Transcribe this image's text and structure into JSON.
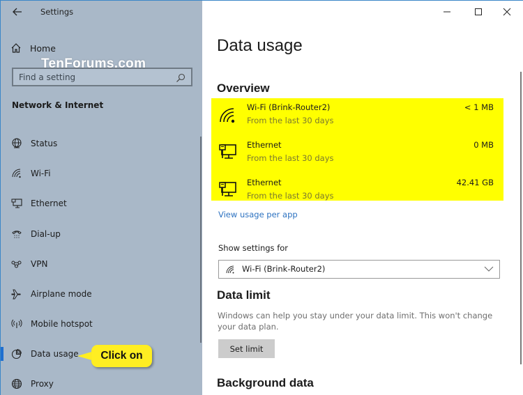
{
  "window": {
    "app_title": "Settings",
    "controls": {
      "minimize": "minimize-icon",
      "maximize": "maximize-icon",
      "close": "close-icon"
    }
  },
  "sidebar": {
    "home_label": "Home",
    "watermark": "TenForums.com",
    "search_placeholder": "Find a setting",
    "section_title": "Network & Internet",
    "items": [
      {
        "label": "Status",
        "icon": "status-globe-icon",
        "active": false
      },
      {
        "label": "Wi-Fi",
        "icon": "wifi-icon",
        "active": false
      },
      {
        "label": "Ethernet",
        "icon": "ethernet-icon",
        "active": false
      },
      {
        "label": "Dial-up",
        "icon": "dialup-phone-icon",
        "active": false
      },
      {
        "label": "VPN",
        "icon": "vpn-icon",
        "active": false
      },
      {
        "label": "Airplane mode",
        "icon": "airplane-icon",
        "active": false
      },
      {
        "label": "Mobile hotspot",
        "icon": "hotspot-icon",
        "active": false
      },
      {
        "label": "Data usage",
        "icon": "pie-chart-icon",
        "active": true
      },
      {
        "label": "Proxy",
        "icon": "globe-icon",
        "active": false
      }
    ]
  },
  "callout": {
    "text": "Click on",
    "color": "#ffee22"
  },
  "main": {
    "page_title": "Data usage",
    "overview": {
      "heading": "Overview",
      "highlight_color": "#ffff00",
      "rows": [
        {
          "name": "Wi-Fi (Brink-Router2)",
          "sub": "From the last 30 days",
          "amount": "< 1 MB",
          "icon": "wifi-icon"
        },
        {
          "name": "Ethernet",
          "sub": "From the last 30 days",
          "amount": "0 MB",
          "icon": "ethernet-icon"
        },
        {
          "name": "Ethernet",
          "sub": "From the last 30 days",
          "amount": "42.41 GB",
          "icon": "ethernet-icon"
        }
      ]
    },
    "view_usage_link": "View usage per app",
    "show_settings_label": "Show settings for",
    "show_settings_selected": "Wi-Fi (Brink-Router2)",
    "data_limit": {
      "heading": "Data limit",
      "description": "Windows can help you stay under your data limit. This won't change your data plan.",
      "button": "Set limit"
    },
    "background_data_heading": "Background data"
  },
  "colors": {
    "accent": "#1e6fd0",
    "link": "#2d72c0",
    "sidebar_bg": "#a9b8c8"
  }
}
